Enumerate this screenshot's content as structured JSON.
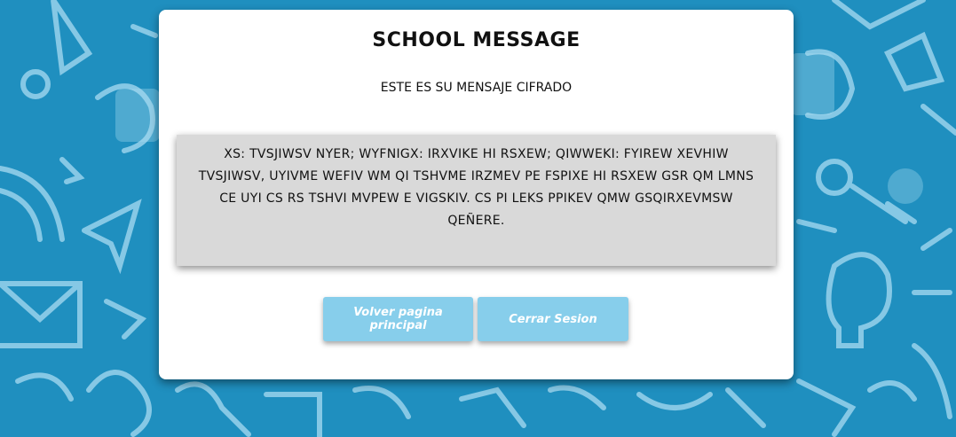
{
  "page": {
    "title": "SCHOOL MESSAGE",
    "subtitle": "ESTE ES SU MENSAJE CIFRADO",
    "cipher_text": "XS: TVSJIWSV NYER; WYFNIGX: IRXVIKE HI RSXEW; QIWWEKI: FYIREW XEVHIW TVSJIWSV, UYIVME WEFIV WM QI TSHVME IRZMEV PE FSPIXE HI RSXEW GSR QM LMNS CE UYI CS RS TSHVI MVPEW E VIGSKIV. CS PI LEKS PPIKEV QMW GSQIRXEVMSW QEÑERE."
  },
  "buttons": {
    "home_label": "Volver pagina principal",
    "logout_label": "Cerrar Sesion"
  },
  "colors": {
    "background": "#1f8fbf",
    "card": "#ffffff",
    "cipher_box": "#d9d9d9",
    "button": "#87ceeb"
  }
}
